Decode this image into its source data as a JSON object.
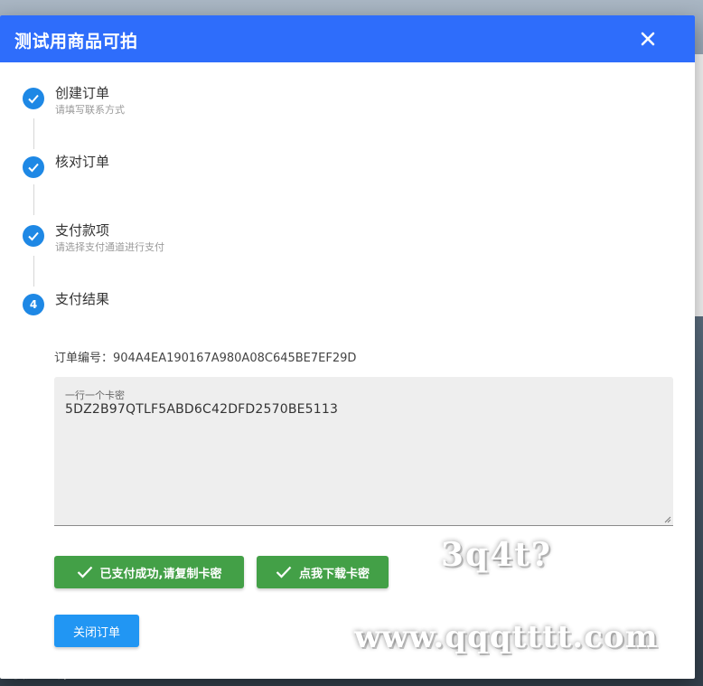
{
  "dialog": {
    "title": "测试用商品可拍",
    "close_icon": "close-icon"
  },
  "steps": [
    {
      "title": "创建订单",
      "subtitle": "请填写联系方式",
      "status": "done",
      "icon": "check-icon"
    },
    {
      "title": "核对订单",
      "subtitle": "",
      "status": "done",
      "icon": "check-icon"
    },
    {
      "title": "支付款项",
      "subtitle": "请选择支付通道进行支付",
      "status": "done",
      "icon": "check-icon"
    },
    {
      "title": "支付结果",
      "subtitle": "",
      "status": "active",
      "number": "4"
    }
  ],
  "order": {
    "label": "订单编号：",
    "number": "904A4EA190167A980A08C645BE7EF29D"
  },
  "card_field": {
    "label": "一行一个卡密",
    "value": "5DZ2B97QTLF5ABD6C42DFD2570BE5113"
  },
  "buttons": {
    "paid": "已支付成功,请复制卡密",
    "download": "点我下载卡密",
    "close_order": "关闭订单"
  },
  "watermarks": {
    "top": "3q4t?",
    "bottom": "www.qqqtttt.com"
  },
  "background": {
    "partial_text": "法使用除外)"
  },
  "colors": {
    "header": "#2e6dfb",
    "step_blue": "#1e88e5",
    "success_green": "#43a047",
    "button_blue": "#2196f3"
  }
}
